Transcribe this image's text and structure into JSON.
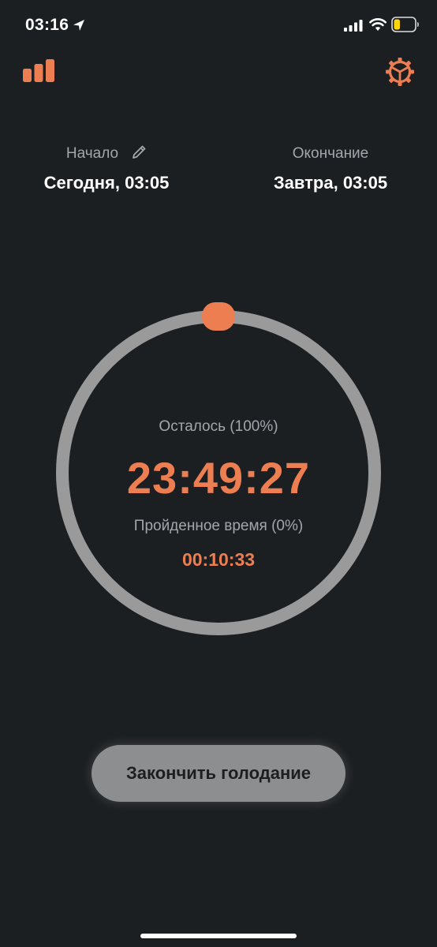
{
  "status_bar": {
    "time": "03:16",
    "icons": [
      "location-arrow-icon",
      "signal-bars-icon",
      "wifi-icon",
      "battery-icon"
    ],
    "battery_level": 0.3
  },
  "app_bar": {
    "left_icon": "stats-bars-icon",
    "right_icon": "gear-icon"
  },
  "start": {
    "label": "Начало",
    "value": "Сегодня, 03:05",
    "edit_icon": "pencil-icon"
  },
  "end": {
    "label": "Окончание",
    "value": "Завтра, 03:05"
  },
  "progress": {
    "fraction": 0.0
  },
  "remaining": {
    "label": "Осталось (100%)",
    "value": "23:49:27"
  },
  "elapsed": {
    "label": "Пройденное время (0%)",
    "value": "00:10:33"
  },
  "actions": {
    "end_fast_label": "Закончить голодание"
  },
  "colors": {
    "background": "#1c1f22",
    "accent": "#ec7e52",
    "ring": "#9a9a9a",
    "muted_text": "#a3a6aa",
    "button_bg": "#8d8e90"
  }
}
